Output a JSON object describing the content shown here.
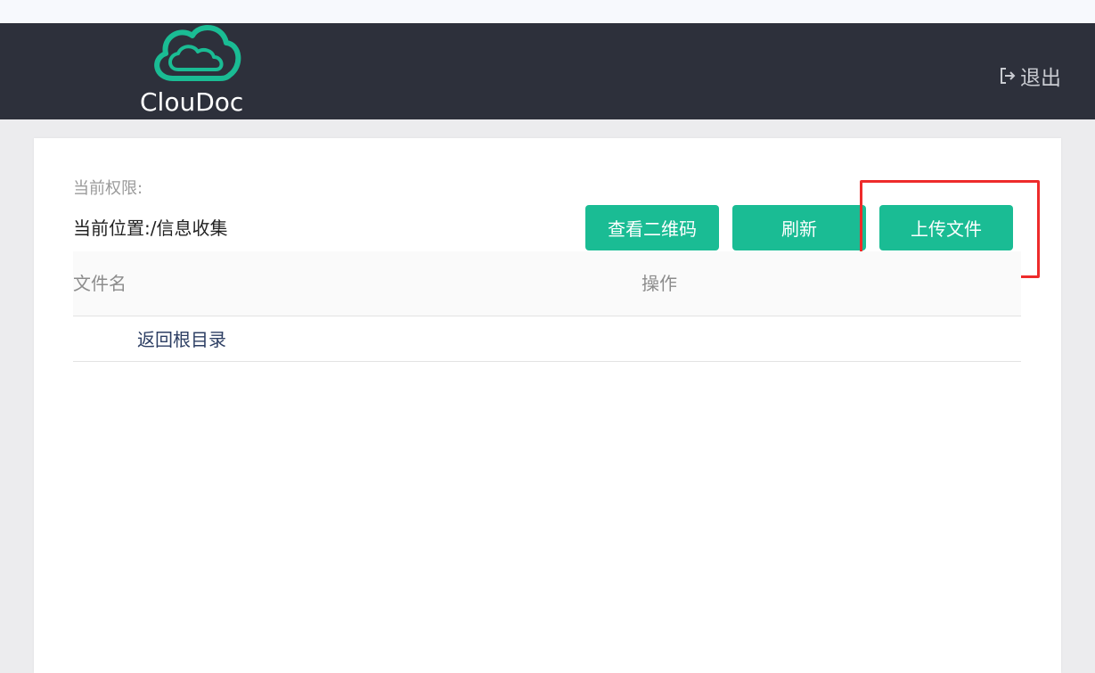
{
  "app": {
    "logo_text": "ClouDoc",
    "brand_color": "#1abc94",
    "header_color": "#2d303b"
  },
  "header": {
    "logout_label": "退出",
    "logout_icon": "logout-icon"
  },
  "panel": {
    "permission_label": "当前权限:",
    "location_label": "当前位置:",
    "location_path": "/信息收集"
  },
  "toolbar": {
    "qr_label": "查看二维码",
    "refresh_label": "刷新",
    "upload_label": "上传文件",
    "highlight_color": "#ee2b2b"
  },
  "table": {
    "columns": [
      "文件名",
      "操作"
    ],
    "rows": [
      {
        "name": "返回根目录"
      }
    ]
  }
}
